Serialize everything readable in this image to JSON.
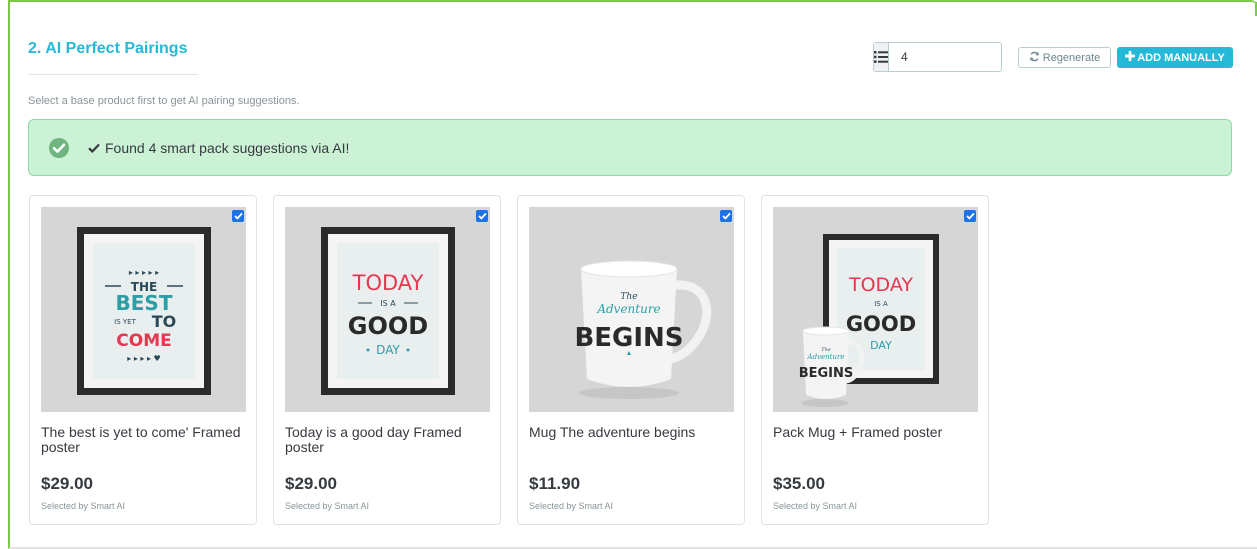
{
  "section": {
    "title": "2. AI Perfect Pairings",
    "hint": "Select a base product first to get AI pairing suggestions."
  },
  "toolbar": {
    "count_icon": "list-icon",
    "count_value": "4",
    "regenerate_label": "Regenerate",
    "regenerate_icon": "refresh-icon",
    "add_manually_label": "ADD MANUALLY",
    "add_manually_icon": "plus-icon"
  },
  "alert": {
    "icon": "check-circle-icon",
    "text": "Found 4 smart pack suggestions via AI!",
    "text_icon": "checkmark-icon"
  },
  "products": [
    {
      "name": "The best is yet to come' Framed poster",
      "price": "$29.00",
      "source": "Selected by Smart AI",
      "checked": true,
      "image": "framed-poster"
    },
    {
      "name": "Today is a good day Framed poster",
      "price": "$29.00",
      "source": "Selected by Smart AI",
      "checked": true,
      "image": "framed-poster"
    },
    {
      "name": "Mug The adventure begins",
      "price": "$11.90",
      "source": "Selected by Smart AI",
      "checked": true,
      "image": "mug"
    },
    {
      "name": "Pack Mug + Framed poster",
      "price": "$35.00",
      "source": "Selected by Smart AI",
      "checked": true,
      "image": "pack"
    }
  ],
  "artwork": {
    "poster1": {
      "line1": "THE",
      "line2": "BEST",
      "line3": "IS YET",
      "line4": "TO",
      "line5": "COME"
    },
    "poster2": {
      "line1": "TODAY",
      "line2": "IS A",
      "line3": "GOOD",
      "line4": "DAY"
    },
    "mug": {
      "line1": "The",
      "line2": "Adventure",
      "line3": "BEGINS"
    }
  },
  "colors": {
    "accent": "#25b9d7",
    "success_bg": "#cbf2d4",
    "success_icon": "#70b580",
    "panel_border": "#7cc84a",
    "checkbox": "#1a73e8",
    "poster_red": "#e8364f",
    "poster_teal": "#2a9fa6"
  }
}
